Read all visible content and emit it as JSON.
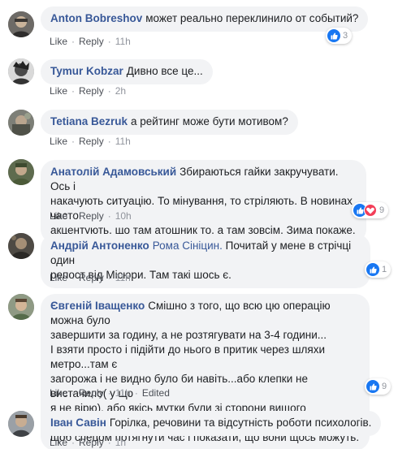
{
  "comments": [
    {
      "author": "Anton Bobreshov",
      "text": "может реально переклинило от событий?",
      "like": "Like",
      "reply": "Reply",
      "time": "11h",
      "reactions": "3"
    },
    {
      "author": "Tymur Kobzar",
      "text": "Дивно все це...",
      "like": "Like",
      "reply": "Reply",
      "time": "2h"
    },
    {
      "author": "Tetiana Bezruk",
      "text": "а рейтинг може бути мотивом?",
      "like": "Like",
      "reply": "Reply",
      "time": "11h"
    },
    {
      "author": "Анатолій Адамовський",
      "text_lines": [
        "Збираються гайки закручувати. Ось і",
        "накачують ситуацію. То мінування, то стріляють. В новинах часто",
        "акцентують, що там атошник то, а там зовсім. Зима покаже."
      ],
      "like": "Like",
      "reply": "Reply",
      "time": "10h",
      "reactions": "9"
    },
    {
      "author": "Андрій Антоненко",
      "mention": "Рома Сініцин.",
      "text_lines": [
        "Почитай у мене в стрічці один",
        "репост від Місюри. Там такі шось є."
      ],
      "like": "Like",
      "reply": "Reply",
      "time": "11h",
      "reactions": "1"
    },
    {
      "author": "Євгеній Іващенко",
      "text_lines": [
        "Смішно з того, що всю цю операцію можна було",
        "завершити за годину, а не розтягувати на 3-4 години...",
        "І взяти просто і підійти до нього в притик через шляхи метро...там є",
        "загорожа і не видно було би навіть...або клепки не вистачило( у що",
        "я не вірю), або якісь мутки були зі сторони вищого командування,",
        "щоб спецом потягнути час і показати, що вони щось можуть."
      ],
      "like": "Like",
      "reply": "Reply",
      "time": "11h",
      "edited": "Edited",
      "reactions": "9"
    },
    {
      "author": "Іван Савін",
      "text": "Горілка, речовини та відсутність роботи психологів.",
      "like": "Like",
      "reply": "Reply",
      "time": "1h"
    }
  ],
  "colors": {
    "author": "#385898",
    "bubble": "#f2f3f5",
    "meta": "#90949c",
    "like_reaction": "#1877f2",
    "love_reaction": "#f33e58"
  },
  "reaction_icons": [
    "like-icon",
    "love-icon"
  ]
}
